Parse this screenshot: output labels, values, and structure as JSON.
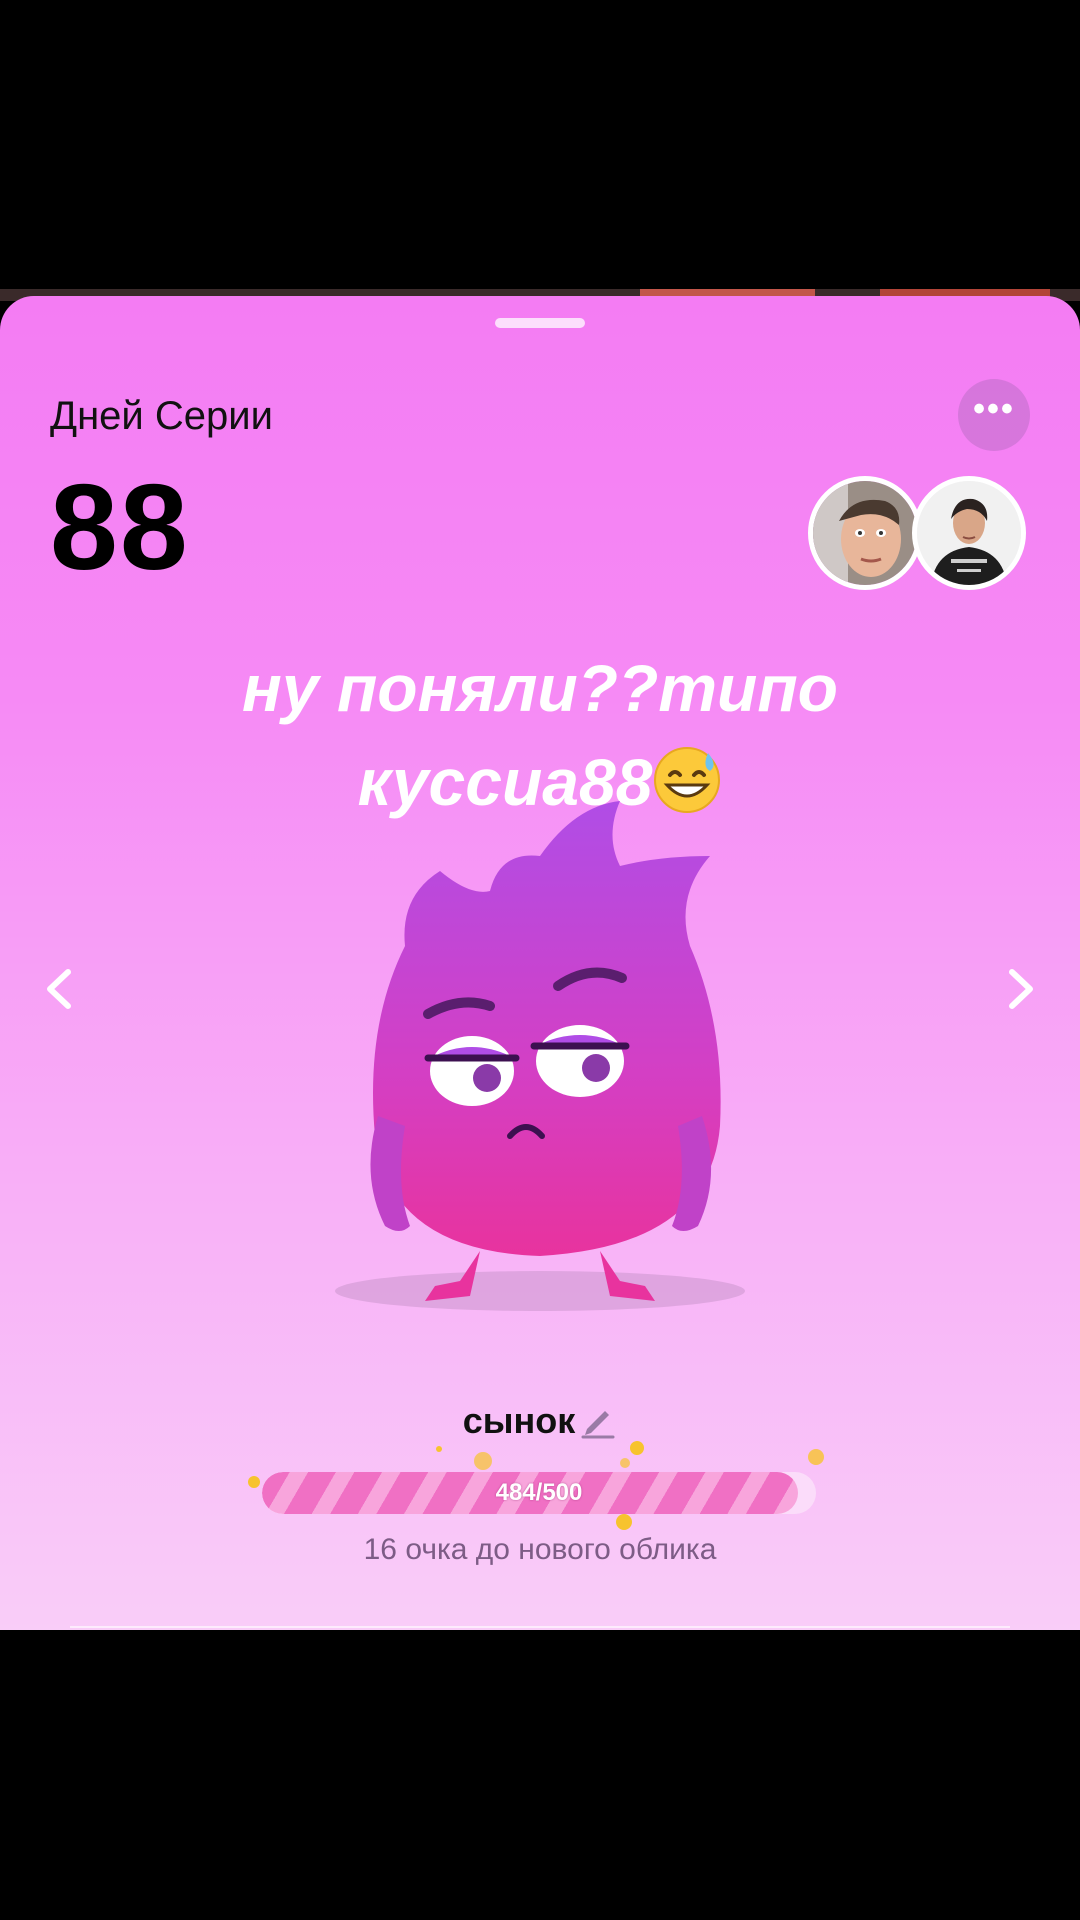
{
  "streak": {
    "label": "Дней Серии",
    "count": "88"
  },
  "caption": {
    "line1": "ну поняли??типо",
    "line2": "куссиа88"
  },
  "caption_emoji_icon": "grinning-sweat-emoji",
  "mascot": {
    "icon": "purple-flame-mascot"
  },
  "nickname": {
    "text": "сынок",
    "icon": "pencil-icon"
  },
  "progress": {
    "text": "484/500",
    "current": 484,
    "max": 500,
    "fraction": 0.968,
    "hint": "16 очка до нового облика"
  },
  "colors": {
    "sheet_top": "#f47cf3",
    "sheet_bottom": "#f9cdf8",
    "progress_fill": "#f070c4",
    "sparkle": "#f7c32e"
  }
}
